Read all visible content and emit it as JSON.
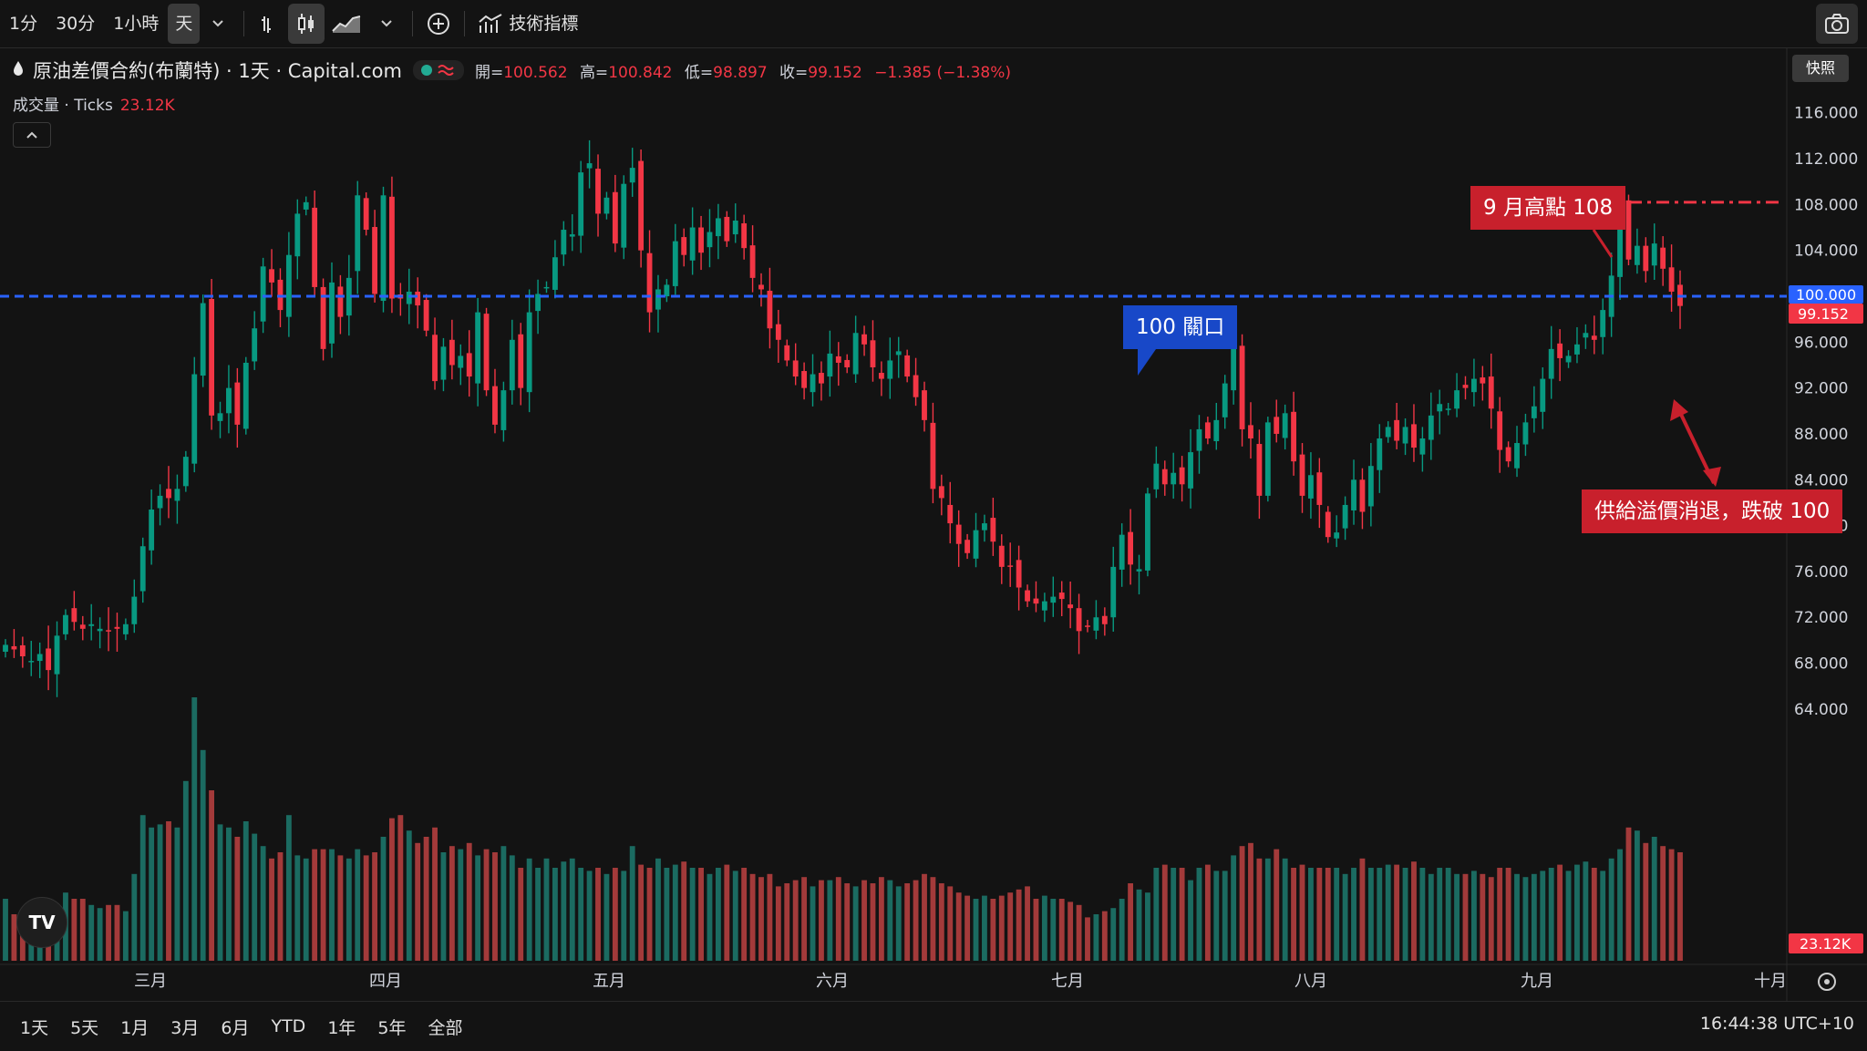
{
  "toolbar": {
    "intervals": [
      "1分",
      "30分",
      "1小時",
      "天"
    ],
    "active_interval": "天",
    "indicators_label": "技術指標"
  },
  "legend": {
    "symbol": "原油差價合約(布蘭特) · 1天 · Capital.com",
    "open_label": "開=",
    "open": "100.562",
    "high_label": "高=",
    "high": "100.842",
    "low_label": "低=",
    "low": "98.897",
    "close_label": "收=",
    "close": "99.152",
    "change": "−1.385 (−1.38%)"
  },
  "volume_legend": {
    "label": "成交量 · Ticks",
    "value": "23.12K"
  },
  "snapshot_label": "快照",
  "ranges": [
    "1天",
    "5天",
    "1月",
    "3月",
    "6月",
    "YTD",
    "1年",
    "5年",
    "全部"
  ],
  "clock": "16:44:38 UTC+10",
  "annotations": {
    "level_100": "100 關口",
    "sept_high": "9 月高點 108",
    "break_note": "供給溢價消退，跌破 100"
  },
  "colors": {
    "up": "#089981",
    "down": "#f23645",
    "blue_line": "#2962ff",
    "red_box": "#c8202c",
    "blue_box": "#1848c8"
  },
  "chart_data": {
    "type": "candlestick",
    "y_axis": {
      "min": 62,
      "max": 122,
      "ticks": [
        "116.000",
        "112.000",
        "108.000",
        "104.000",
        "100.000",
        "96.000",
        "92.000",
        "88.000",
        "84.000",
        "80.000",
        "76.000",
        "72.000",
        "68.000",
        "64.000"
      ]
    },
    "x_axis_labels": [
      "三月",
      "四月",
      "五月",
      "六月",
      "七月",
      "八月",
      "九月",
      "十月"
    ],
    "last_price_label": "99.152",
    "line_level_label": "100.000",
    "volume_last_label": "23.12K",
    "horizontal_lines": [
      {
        "value": 100,
        "style": "dashed",
        "color": "#2962ff"
      },
      {
        "value": 108.2,
        "style": "dash-dot",
        "color": "#f23645"
      }
    ],
    "closes": [
      69.6,
      69.2,
      68.6,
      68.2,
      68.8,
      67.4,
      70.4,
      72.2,
      71.6,
      71.0,
      71.4,
      71.0,
      70.8,
      71.0,
      71.4,
      73.8,
      78.2,
      81.4,
      82.6,
      82.4,
      83.2,
      86.0,
      93.2,
      99.4,
      89.6,
      89.8,
      92.0,
      88.8,
      94.2,
      97.2,
      102.6,
      101.2,
      98.8,
      103.6,
      107.2,
      108.2,
      100.8,
      95.4,
      101.2,
      98.2,
      101.6,
      108.8,
      105.8,
      100.2,
      108.8,
      99.8,
      99.8,
      100.4,
      99.2,
      97.0,
      92.6,
      95.6,
      94.0,
      94.8,
      93.0,
      98.6,
      91.8,
      88.8,
      91.8,
      96.2,
      92.0,
      98.6,
      100.2,
      100.8,
      103.4,
      105.8,
      105.4,
      110.8,
      111.6,
      107.2,
      108.6,
      104.6,
      109.8,
      111.2,
      104.0,
      98.6,
      100.6,
      101.0,
      104.8,
      103.6,
      106.0,
      103.8,
      105.6,
      106.8,
      104.8,
      106.6,
      104.2,
      101.6,
      100.6,
      97.2,
      96.2,
      94.4,
      93.0,
      92.0,
      93.2,
      92.4,
      95.0,
      94.2,
      93.8,
      96.8,
      95.8,
      93.8,
      92.8,
      94.4,
      95.2,
      93.0,
      91.2,
      89.2,
      83.2,
      82.4,
      80.2,
      78.4,
      77.6,
      79.6,
      80.2,
      78.6,
      76.4,
      76.4,
      74.6,
      73.4,
      73.2,
      73.4,
      73.8,
      73.6,
      72.8,
      70.8,
      71.2,
      72.0,
      71.4,
      76.4,
      79.2,
      76.6,
      76.2,
      82.8,
      85.4,
      83.6,
      84.6,
      83.6,
      86.4,
      88.4,
      87.6,
      89.2,
      92.4,
      95.8,
      88.4,
      87.6,
      82.6,
      89.0,
      88.0,
      89.8,
      85.6,
      82.6,
      84.4,
      81.8,
      79.0,
      79.4,
      81.8,
      84.0,
      81.2,
      85.2,
      87.6,
      88.6,
      87.4,
      88.6,
      86.8,
      87.6,
      89.6,
      90.6,
      90.2,
      91.8,
      92.0,
      92.8,
      92.4,
      90.2,
      86.6,
      85.6,
      87.2,
      89.0,
      90.4,
      92.8,
      95.4,
      94.6,
      94.8,
      95.8,
      96.8,
      96.2,
      98.8,
      101.8,
      108.0,
      103.2,
      104.4,
      102.2,
      104.6,
      102.4,
      100.4,
      99.152
    ],
    "volumes": [
      20,
      15,
      16,
      18,
      14,
      17,
      16,
      22,
      20,
      20,
      18,
      17,
      18,
      18,
      16,
      28,
      47,
      43,
      44,
      45,
      43,
      58,
      85,
      68,
      55,
      44,
      43,
      40,
      45,
      41,
      37,
      33,
      35,
      47,
      34,
      33,
      36,
      36,
      36,
      34,
      33,
      36,
      34,
      35,
      40,
      46,
      47,
      42,
      38,
      40,
      43,
      35,
      37,
      36,
      38,
      34,
      36,
      35,
      37,
      34,
      30,
      33,
      30,
      33,
      30,
      32,
      33,
      30,
      29,
      30,
      28,
      30,
      29,
      37,
      31,
      30,
      33,
      30,
      31,
      32,
      30,
      30,
      28,
      30,
      31,
      29,
      30,
      28,
      27,
      28,
      24,
      25,
      26,
      27,
      24,
      26,
      26,
      27,
      25,
      24,
      26,
      25,
      27,
      26,
      24,
      25,
      26,
      28,
      27,
      25,
      24,
      22,
      21,
      20,
      21,
      20,
      21,
      22,
      23,
      24,
      20,
      21,
      20,
      20,
      19,
      18,
      14,
      15,
      16,
      17,
      20,
      25,
      23,
      22,
      30,
      31,
      30,
      30,
      26,
      30,
      31,
      29,
      29,
      34,
      37,
      38,
      33,
      33,
      36,
      33,
      30,
      31,
      30,
      30,
      30,
      30,
      28,
      30,
      33,
      30,
      30,
      31,
      31,
      30,
      32,
      30,
      28,
      30,
      30,
      28,
      28,
      29,
      28,
      27,
      30,
      30,
      28,
      27,
      28,
      29,
      30,
      31,
      29,
      31,
      32,
      30,
      29,
      33,
      36,
      43,
      42,
      38,
      40,
      37,
      36,
      35,
      12
    ]
  }
}
